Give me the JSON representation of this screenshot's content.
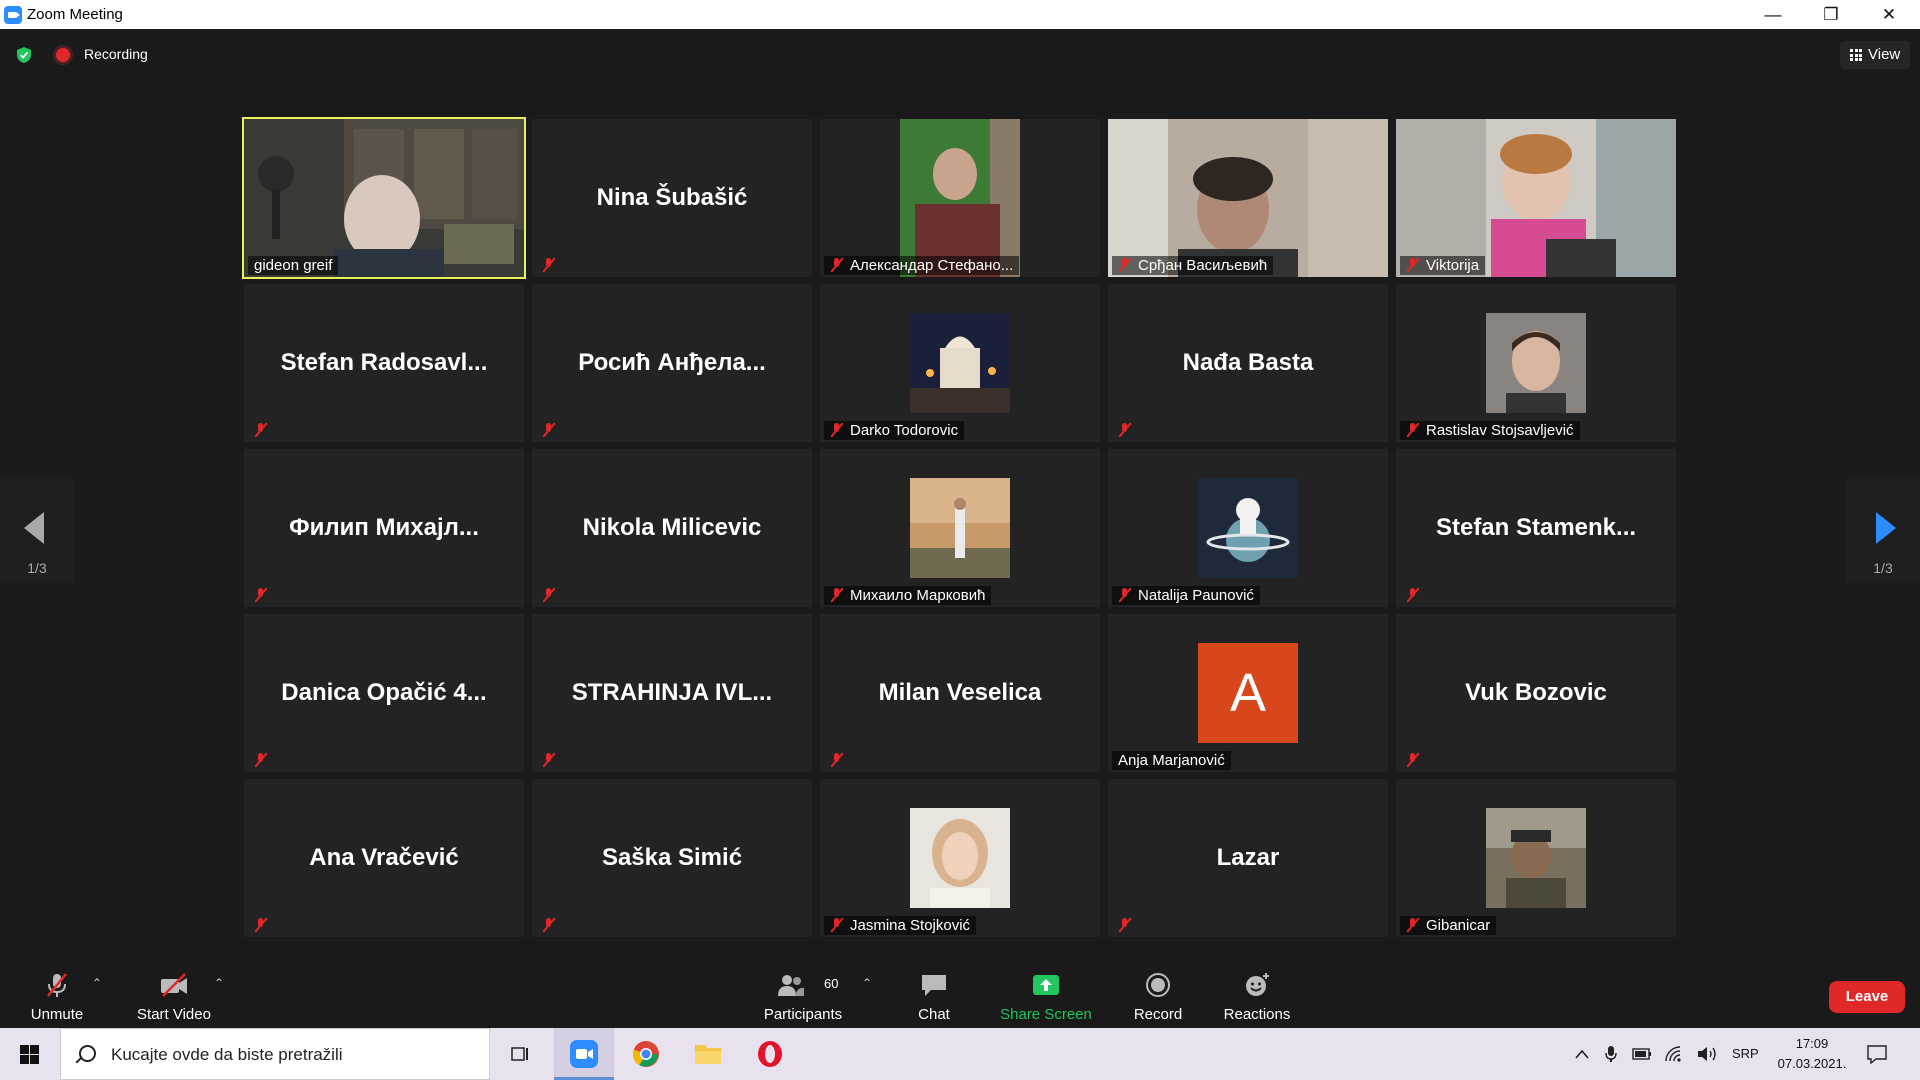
{
  "window": {
    "title": "Zoom Meeting",
    "minimize": "—",
    "restore": "❐",
    "close": "✕"
  },
  "topbar": {
    "recording_label": "Recording",
    "view_label": "View"
  },
  "pager": {
    "left_text": "1/3",
    "right_text": "1/3"
  },
  "tiles": [
    {
      "label": "gideon greif",
      "muted": false,
      "active": true,
      "kind": "video"
    },
    {
      "big_name": "Nina Šubašić",
      "muted": true,
      "kind": "name"
    },
    {
      "label": "Александар Стефано...",
      "muted": true,
      "kind": "video"
    },
    {
      "label": "Срђан Васиљевић",
      "muted": true,
      "kind": "video"
    },
    {
      "label": "Viktorija",
      "muted": true,
      "kind": "video"
    },
    {
      "big_name": "Stefan  Radosavl...",
      "muted": true,
      "kind": "name"
    },
    {
      "big_name": "Росић Анђела...",
      "muted": true,
      "kind": "name"
    },
    {
      "label": "Darko Todorovic",
      "muted": true,
      "kind": "avatar"
    },
    {
      "big_name": "Nađa Basta",
      "muted": true,
      "kind": "name"
    },
    {
      "label": "Rastislav Stojsavljević",
      "muted": true,
      "kind": "avatar"
    },
    {
      "big_name": "Филип  Михајл...",
      "muted": true,
      "kind": "name"
    },
    {
      "big_name": "Nikola Milicevic",
      "muted": true,
      "kind": "name"
    },
    {
      "label": "Михаило Марковић",
      "muted": true,
      "kind": "avatar"
    },
    {
      "label": "Natalija Paunović",
      "muted": true,
      "kind": "avatar"
    },
    {
      "big_name": "Stefan  Stamenk...",
      "muted": true,
      "kind": "name"
    },
    {
      "big_name": "Danica  Opačić  4...",
      "muted": true,
      "kind": "name"
    },
    {
      "big_name": "STRAHINJA  IVL...",
      "muted": true,
      "kind": "name"
    },
    {
      "big_name": "Milan Veselica",
      "muted": true,
      "kind": "name"
    },
    {
      "label": "Anja Marjanović",
      "muted": false,
      "kind": "letter",
      "letter": "A"
    },
    {
      "big_name": "Vuk Bozovic",
      "muted": true,
      "kind": "name"
    },
    {
      "big_name": "Ana Vračević",
      "muted": true,
      "kind": "name"
    },
    {
      "big_name": "Saška Simić",
      "muted": true,
      "kind": "name"
    },
    {
      "label": "Jasmina Stojković",
      "muted": true,
      "kind": "avatar"
    },
    {
      "big_name": "Lazar",
      "muted": true,
      "kind": "name"
    },
    {
      "label": "Gibanicar",
      "muted": true,
      "kind": "avatar"
    }
  ],
  "toolbar": {
    "unmute_label": "Unmute",
    "start_video_label": "Start Video",
    "participants_label": "Participants",
    "participants_count": "60",
    "chat_label": "Chat",
    "share_screen_label": "Share Screen",
    "record_label": "Record",
    "reactions_label": "Reactions",
    "leave_label": "Leave",
    "caret": "⌃"
  },
  "taskbar": {
    "search_placeholder": "Kucajte ovde da biste pretražili",
    "language": "SRP",
    "time": "17:09",
    "date": "07.03.2021."
  },
  "colors": {
    "accent": "#2d8cff",
    "active_speaker": "#e8f25c",
    "leave": "#e02828",
    "share": "#22c55e",
    "letter_avatar": "#d8461b"
  }
}
